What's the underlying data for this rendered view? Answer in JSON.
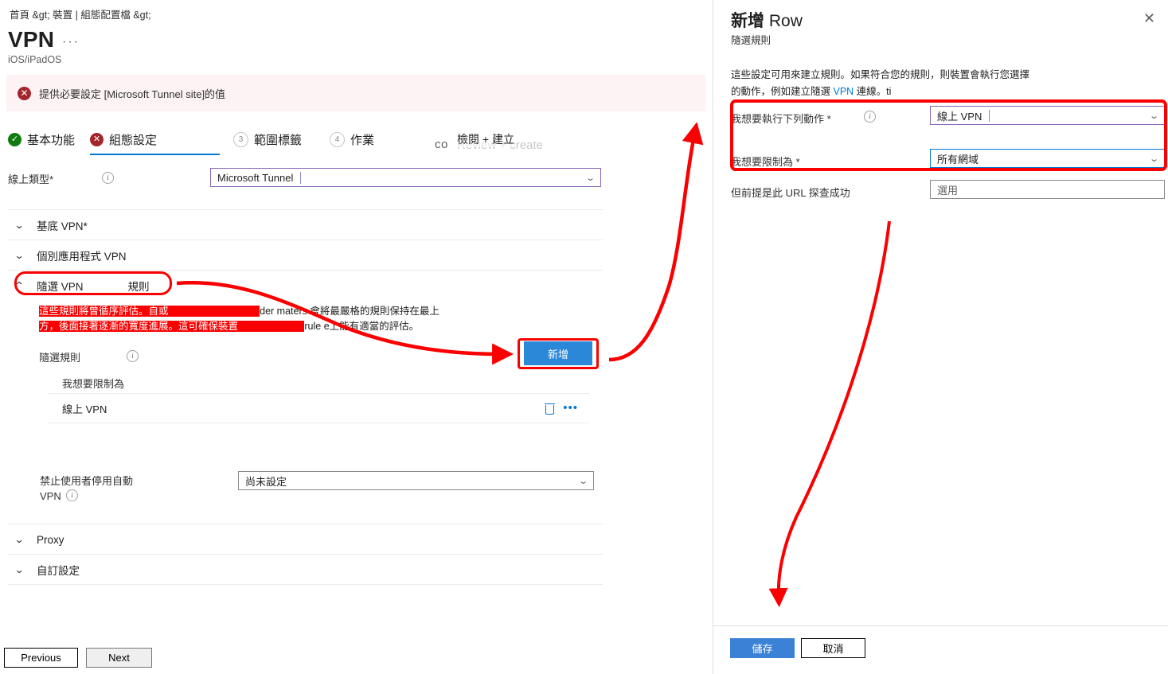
{
  "breadcrumb": {
    "items": [
      "首頁 &gt;",
      "裝置 | 組態配置檔 &gt;"
    ],
    "full": "首頁 &gt;  裝置 | 組態配置檔 &gt;"
  },
  "header": {
    "title": "VPN",
    "ellipsis": "···",
    "subtitle": "iOS/iPadOS"
  },
  "error_banner": {
    "icon": "error-circle-icon",
    "glyph": "✕",
    "text": "提供必要設定 [Microsoft Tunnel site]的值",
    "bg": "#fdf3f4",
    "icon_color": "#a4262c"
  },
  "wizard": {
    "tabs": [
      {
        "label": "基本功能",
        "state": "complete",
        "badge": "✓"
      },
      {
        "label": "組態設定",
        "state": "error",
        "badge": "✕"
      },
      {
        "label": "範圍標籤",
        "state": "number",
        "badge": "3"
      },
      {
        "label": "作業",
        "state": "number",
        "badge": "4"
      }
    ],
    "review_tab": {
      "prefix_fragment": "co",
      "ghost_english": "Review + create",
      "overlay_chinese": "檢閱 + 建立"
    },
    "selected_index": 1,
    "underline_color": "#0078d4"
  },
  "form": {
    "connection_type": {
      "label": "線上類型*",
      "info": "info-icon",
      "value": "Microsoft Tunnel",
      "chevron": "⌄"
    },
    "accordions": [
      {
        "id": "base-vpn",
        "label": "基底 VPN*",
        "expanded": false,
        "chevron": "⌄"
      },
      {
        "id": "per-app",
        "label": "個別應用程式 VPN",
        "expanded": false,
        "chevron": "⌄"
      },
      {
        "id": "proxy",
        "label": "Proxy",
        "expanded": false,
        "chevron": "⌄"
      },
      {
        "id": "custom",
        "label": "自訂設定",
        "expanded": false,
        "chevron": "⌄"
      }
    ],
    "ondemand_accordion": {
      "chevron": "⌃",
      "label_part1": "隨選 VPN",
      "label_part2": "規則",
      "expanded": true,
      "highlight_color": "#fb0000"
    },
    "description": {
      "line1_redacted": "這些規則將曾循序評估。自或",
      "line1_mid_redacted": "",
      "line1_tail": "der maters 會將最嚴格的規則保持在最上",
      "line2_redacted": "方，後面接著逐漸的寬度進展。這可確保裝置",
      "line2_tail": "rule e上能有適當的評估。"
    },
    "ondemand_rules": {
      "label": "隨選規則",
      "info": "info-icon",
      "add_button": "新增",
      "add_button_color": "#2b88d8",
      "column_header": "我想要限制為",
      "rows": [
        {
          "value": "線上 VPN",
          "delete_icon": "trash-icon",
          "more_icon": "more-ellipsis-icon"
        }
      ]
    },
    "disable_auto_vpn": {
      "label_line1": "禁止使用者停用自動",
      "label_line2": "VPN",
      "info": "info-icon",
      "value": "尚未設定",
      "chevron": "⌄"
    }
  },
  "footer": {
    "previous": "Previous",
    "next": "Next"
  },
  "side_panel": {
    "title_bold": "新增",
    "title_regular": "Row",
    "subtitle": "隨選規則",
    "close_icon": "close-icon",
    "close_glyph": "✕",
    "description_line1": "這些設定可用來建立規則。如果符合您的規則，則裝置會執行您選擇",
    "description_line2_pre": "的動作，例如建立隨選 ",
    "description_line2_link": "VPN",
    "description_line2_post": " 連線。ti",
    "fields": [
      {
        "label": "我想要執行下列動作 *",
        "info": "info-icon",
        "value": "線上 VPN",
        "control": "dropdown",
        "focus": "purple",
        "chevron": "⌄"
      },
      {
        "label": "我想要限制為 *",
        "value": "所有網域",
        "control": "dropdown",
        "focus": "blue",
        "chevron": "⌄"
      },
      {
        "label": "但前提是此 URL 探查成功",
        "value": "選用",
        "control": "textbox",
        "placeholder": "選用"
      }
    ],
    "highlight_color": "#fb0000",
    "save": "儲存",
    "cancel": "取消",
    "save_color": "#3b82d6"
  },
  "annotations": {
    "arrow_color": "#fb0000",
    "arrows": [
      {
        "name": "accordion-to-add-button"
      },
      {
        "name": "add-button-to-side-panel"
      },
      {
        "name": "side-panel-to-save-button"
      }
    ]
  }
}
